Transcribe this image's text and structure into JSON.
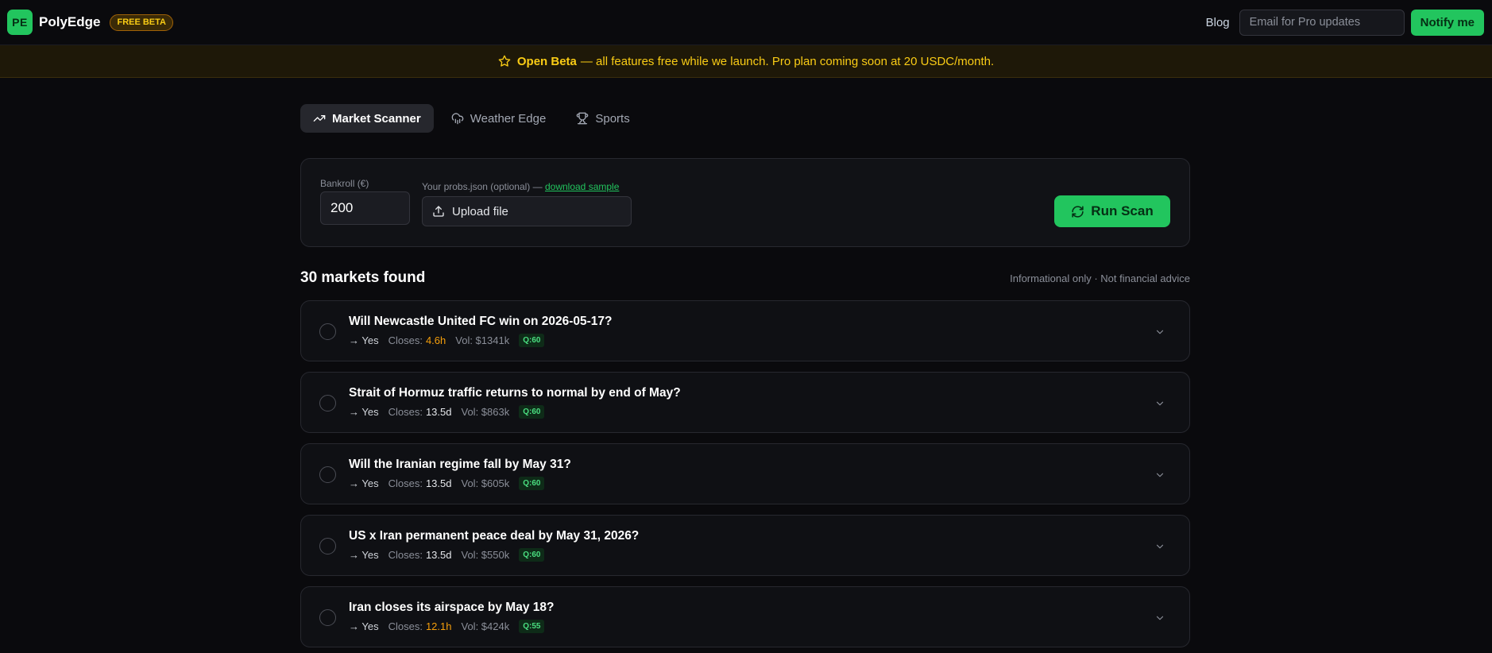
{
  "header": {
    "logo_initials": "PE",
    "brand": "PolyEdge",
    "badge": "FREE BETA",
    "blog_label": "Blog",
    "email_placeholder": "Email for Pro updates",
    "notify_label": "Notify me"
  },
  "banner": {
    "strong": "Open Beta",
    "text": "— all features free while we launch. Pro plan coming soon at 20 USDC/month."
  },
  "tabs": [
    {
      "label": "Market Scanner",
      "active": true,
      "icon": "trending-up-icon"
    },
    {
      "label": "Weather Edge",
      "active": false,
      "icon": "cloud-rain-icon"
    },
    {
      "label": "Sports",
      "active": false,
      "icon": "trophy-icon"
    }
  ],
  "scan": {
    "bankroll_label": "Bankroll (€)",
    "bankroll_value": "200",
    "probs_label": "Your probs.json (optional) —",
    "download_label": "download sample",
    "upload_label": "Upload file",
    "run_label": "Run Scan"
  },
  "results": {
    "title": "30 markets found",
    "disclaimer": "Informational only · Not financial advice"
  },
  "markets": [
    {
      "title": "Will Newcastle United FC win on 2026-05-17?",
      "side": "→ Yes",
      "closes_label": "Closes:",
      "closes": "4.6h",
      "soon": true,
      "vol": "Vol: $1341k",
      "q": "Q:60"
    },
    {
      "title": "Strait of Hormuz traffic returns to normal by end of May?",
      "side": "→ Yes",
      "closes_label": "Closes:",
      "closes": "13.5d",
      "soon": false,
      "vol": "Vol: $863k",
      "q": "Q:60"
    },
    {
      "title": "Will the Iranian regime fall by May 31?",
      "side": "→ Yes",
      "closes_label": "Closes:",
      "closes": "13.5d",
      "soon": false,
      "vol": "Vol: $605k",
      "q": "Q:60"
    },
    {
      "title": "US x Iran permanent peace deal by May 31, 2026?",
      "side": "→ Yes",
      "closes_label": "Closes:",
      "closes": "13.5d",
      "soon": false,
      "vol": "Vol: $550k",
      "q": "Q:60"
    },
    {
      "title": "Iran closes its airspace by May 18?",
      "side": "→ Yes",
      "closes_label": "Closes:",
      "closes": "12.1h",
      "soon": true,
      "vol": "Vol: $424k",
      "q": "Q:55"
    }
  ],
  "colors": {
    "accent": "#22c55e",
    "warning": "#facc15",
    "soon": "#f59e0b",
    "background": "#0a0a0d"
  }
}
